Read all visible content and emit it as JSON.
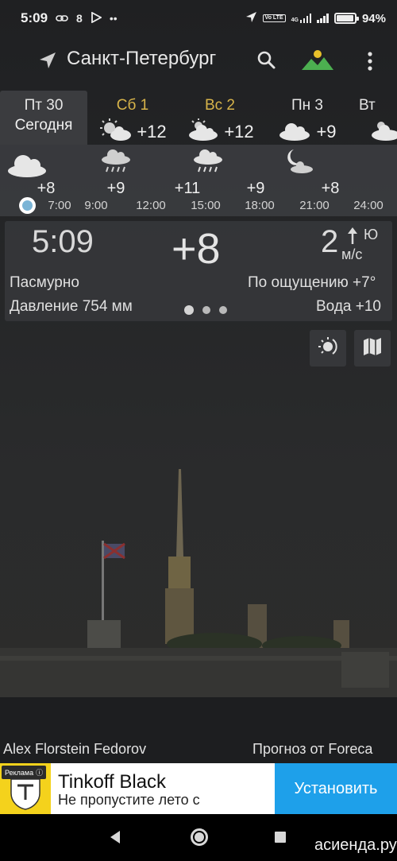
{
  "status_bar": {
    "time": "5:09",
    "notif_count": "8",
    "network": "4G",
    "volte": "Vo LTE",
    "battery": "94%",
    "battery_level": 0.94
  },
  "header": {
    "city": "Санкт-Петербург"
  },
  "days": [
    {
      "name": "Пт 30",
      "sub": "Сегодня",
      "selected": true
    },
    {
      "name": "Сб 1",
      "icon": "sun-cloud-icon",
      "temp": "+12",
      "accent": "#d8b44a"
    },
    {
      "name": "Вс 2",
      "icon": "cloud-sun-icon",
      "temp": "+12",
      "accent": "#d8b44a"
    },
    {
      "name": "Пн 3",
      "icon": "cloud-icon",
      "temp": "+9"
    },
    {
      "name": "Вт",
      "icon": "cloud-sun-icon",
      "temp": ""
    }
  ],
  "hourly": [
    {
      "time": "",
      "temp": "+8",
      "icon": "cloud-icon"
    },
    {
      "time": "7:00",
      "temp": "",
      "icon": ""
    },
    {
      "time": "9:00",
      "temp": "+9",
      "icon": "rain-cloud-icon"
    },
    {
      "time": "12:00",
      "temp": "+11",
      "icon": ""
    },
    {
      "time": "15:00",
      "temp": "",
      "icon": "rain-cloud-icon"
    },
    {
      "time": "18:00",
      "temp": "+9",
      "icon": ""
    },
    {
      "time": "21:00",
      "temp": "+8",
      "icon": "moon-cloud-icon"
    },
    {
      "time": "24:00",
      "temp": "",
      "icon": ""
    }
  ],
  "current": {
    "time": "5:09",
    "temp": "+8",
    "wind_speed": "2",
    "wind_dir": "Ю",
    "wind_unit": "м/с",
    "condition": "Пасмурно",
    "feels_like": "По ощущению +7°",
    "pressure": "Давление 754 мм",
    "water": "Вода +10"
  },
  "credits": {
    "photo": "Alex Florstein Fedorov",
    "forecast": "Прогноз от Foreca"
  },
  "ad": {
    "badge": "Реклама",
    "title": "Tinkoff Black",
    "subtitle": "Не пропустите лето с",
    "button": "Установить"
  },
  "watermark": "асиенда.ру",
  "colors": {
    "accent_yellow": "#d8b44a",
    "ad_button": "#1ea0ea",
    "landscape_icon": "#e8c02a"
  }
}
